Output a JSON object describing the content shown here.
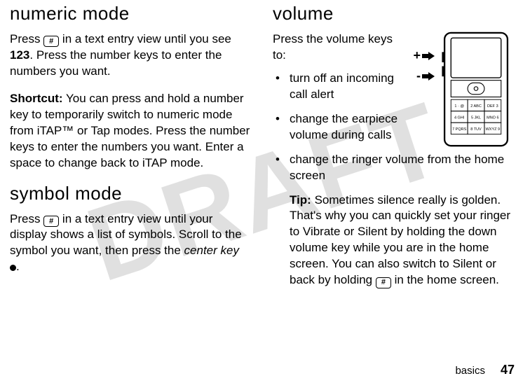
{
  "watermark": "DRAFT",
  "left": {
    "heading1": "numeric mode",
    "para1_a": "Press ",
    "para1_b": " in a text entry view until you see ",
    "para1_big123": "123",
    "para1_c": ". Press the number keys to enter the numbers you want.",
    "para2_label": "Shortcut:",
    "para2_body": " You can press and hold a number key to temporarily switch to numeric mode from iTAP™ or Tap modes. Press the number keys to enter the numbers you want. Enter a space to change back to iTAP mode.",
    "heading2": "symbol mode",
    "para3_a": "Press ",
    "para3_b": " in a text entry view until your display shows a list of symbols. Scroll to the symbol you want, then press the ",
    "para3_center_key": "center key",
    "para3_c": ".",
    "hash_key": "#"
  },
  "right": {
    "heading": "volume",
    "intro": "Press the volume keys to:",
    "bullet1": "turn off an incoming call alert",
    "bullet2": "change the earpiece volume during calls",
    "bullet3": "change the ringer volume from the home screen",
    "tip_label": "Tip:",
    "tip_a": " Sometimes silence really is golden. That's why you can quickly set your ringer to ",
    "tip_vibrate": "Vibrate",
    "tip_or": " or ",
    "tip_silent": "Silent",
    "tip_b": " by holding the down volume key while you are in the home screen. You can also switch to ",
    "tip_silent2": "Silent",
    "tip_c": " or back by holding ",
    "tip_d": " in the home screen.",
    "hash_key": "#",
    "plus": "+",
    "minus": "-"
  },
  "footer": {
    "label": "basics",
    "page": "47"
  },
  "phone_keys": {
    "r1": [
      "1 · @",
      "2 ABC",
      "DEF 3"
    ],
    "r2": [
      "4 GHI",
      "5 JKL",
      "MNO 6"
    ],
    "r3": [
      "7 PQRS",
      "8 TUV",
      "WXYZ 9"
    ]
  }
}
